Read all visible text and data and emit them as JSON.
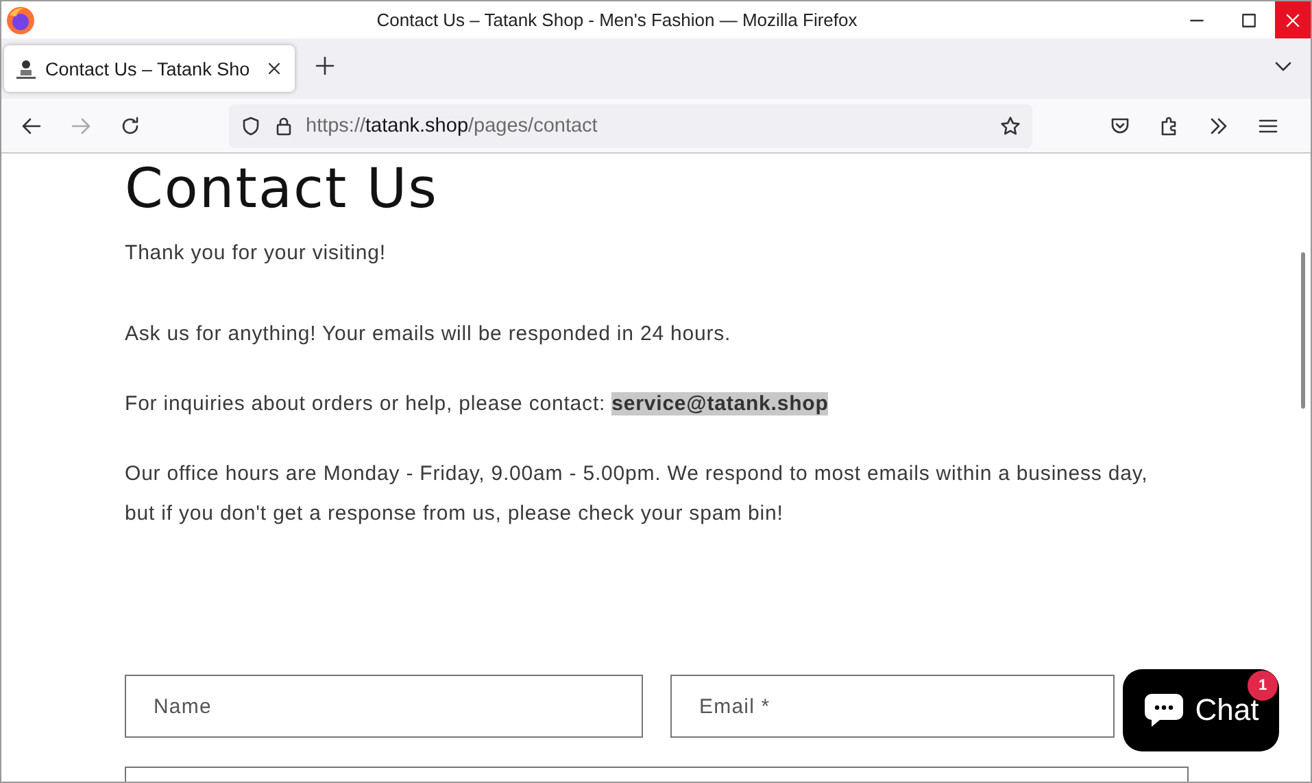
{
  "window": {
    "title": "Contact Us – Tatank Shop - Men's Fashion — Mozilla Firefox"
  },
  "tabs": [
    {
      "label": "Contact Us – Tatank Sho",
      "selected": true
    }
  ],
  "address_bar": {
    "scheme": "https://",
    "domain": "tatank.shop",
    "path": "/pages/contact"
  },
  "page": {
    "heading": "Contact Us",
    "paragraphs": [
      "Thank you for your visiting!",
      "Ask us for anything! Your emails will be responded in 24 hours.",
      "For inquiries about orders or help, please contact: **service@tatank.shop**",
      "Our office hours are Monday - Friday, 9.00am - 5.00pm. We respond to most emails within a business day, but if you don't get a response from us, please check your spam bin!"
    ],
    "fields": [
      {
        "placeholder": "Name"
      },
      {
        "placeholder": "Email *"
      }
    ]
  },
  "chat": {
    "label": "Chat",
    "badge": "1"
  }
}
